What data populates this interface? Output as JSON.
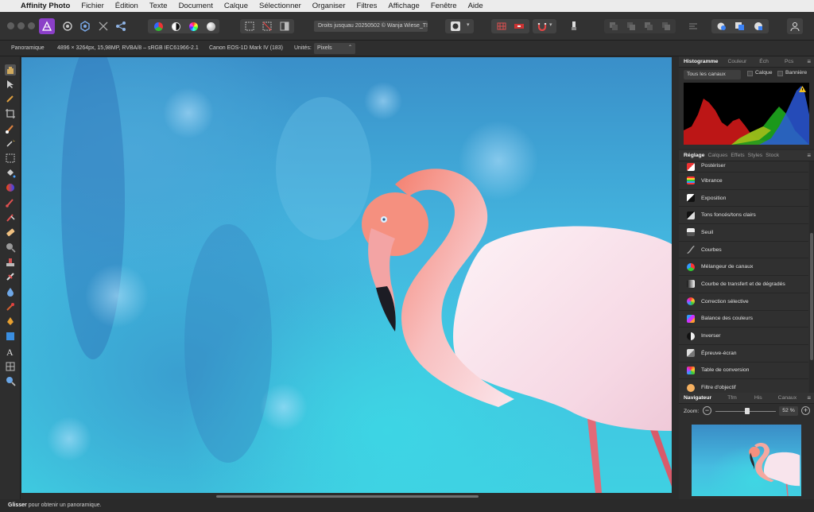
{
  "menubar": {
    "app_name": "Affinity Photo",
    "items": [
      "Fichier",
      "Édition",
      "Texte",
      "Document",
      "Calque",
      "Sélectionner",
      "Organiser",
      "Filtres",
      "Affichage",
      "Fenêtre",
      "Aide"
    ]
  },
  "toolbar": {
    "document_title": "Droits jusquau 20250502 © Wanja Wiese_T!"
  },
  "context_bar": {
    "persona": "Panoramique",
    "image_info": "4896 × 3264px, 15,98MP, RVBA/8 – sRGB IEC61966-2.1",
    "camera": "Canon EOS-1D Mark IV (183)",
    "units_label": "Unités:",
    "units_value": "Pixels"
  },
  "histogram_panel": {
    "tabs": [
      "Histogramme",
      "Couleur",
      "Éch",
      "Pcs"
    ],
    "channels": "Tous les canaux",
    "layer_label": "Calque",
    "banner_label": "Bannière",
    "warning_icon": "warning-icon"
  },
  "adjustments_panel": {
    "tabs": [
      "Réglage",
      "Calques",
      "Effets",
      "Styles",
      "Stock"
    ],
    "items": [
      {
        "label": "Postériser",
        "icon": "posterize-icon"
      },
      {
        "label": "Vibrance",
        "icon": "vibrance-icon"
      },
      {
        "label": "Exposition",
        "icon": "exposure-icon"
      },
      {
        "label": "Tons foncés/tons clairs",
        "icon": "shadows-highlights-icon"
      },
      {
        "label": "Seuil",
        "icon": "threshold-icon"
      },
      {
        "label": "Courbes",
        "icon": "curves-icon"
      },
      {
        "label": "Mélangeur de canaux",
        "icon": "channel-mixer-icon"
      },
      {
        "label": "Courbe de transfert et de dégradés",
        "icon": "gradient-map-icon"
      },
      {
        "label": "Correction sélective",
        "icon": "selective-color-icon"
      },
      {
        "label": "Balance des couleurs",
        "icon": "color-balance-icon"
      },
      {
        "label": "Inverser",
        "icon": "invert-icon"
      },
      {
        "label": "Épreuve-écran",
        "icon": "soft-proof-icon"
      },
      {
        "label": "Table de conversion",
        "icon": "lut-icon"
      },
      {
        "label": "Filtre d'objectif",
        "icon": "lens-filter-icon"
      }
    ]
  },
  "navigator_panel": {
    "tabs": [
      "Navigateur",
      "Tfm",
      "His",
      "Canaux"
    ],
    "zoom_label": "Zoom:",
    "zoom_value": "52 %",
    "zoom_fraction": 0.52
  },
  "status_bar": {
    "action": "Glisser",
    "message": "pour obtenir un panoramique."
  },
  "colors": {
    "accent": "#8b3fc8",
    "panel_bg": "#2e2e2e"
  }
}
